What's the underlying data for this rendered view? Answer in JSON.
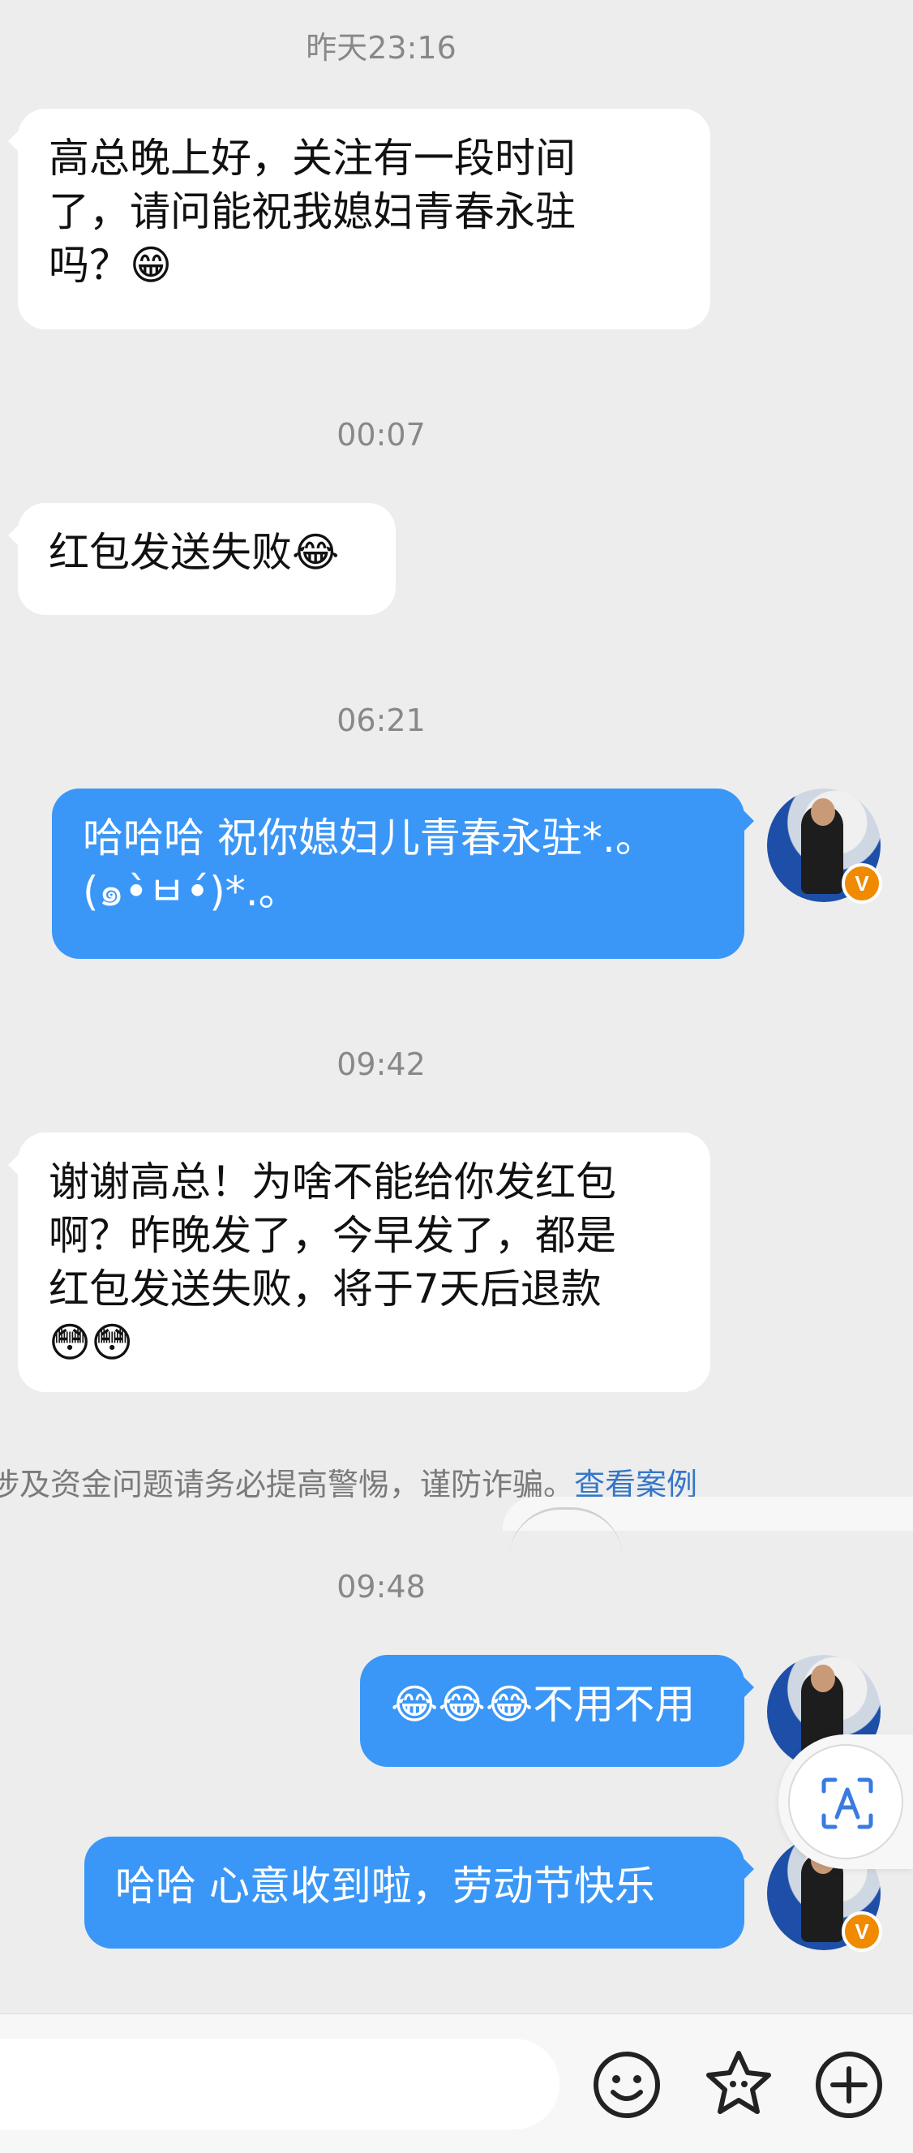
{
  "messages": [
    {
      "time": "昨天23:16",
      "side": "in",
      "lines": [
        "高总晚上好，关注有一段时间",
        "了，请问能祝我媳妇青春永驻",
        "吗？😁"
      ]
    },
    {
      "time": "00:07",
      "side": "in",
      "lines": [
        "红包发送失败😂"
      ]
    },
    {
      "time": "06:21",
      "side": "out",
      "lines": [
        "哈哈哈 祝你媳妇儿青春永驻*.。",
        "(๑•̀ㅂ•́)*.。"
      ]
    },
    {
      "time": "09:42",
      "side": "in",
      "lines": [
        "谢谢高总！为啥不能给你发红包",
        "啊？昨晚发了，今早发了，都是",
        "红包发送失败，将于7天后退款",
        "😳😳"
      ]
    },
    {
      "time": "09:48",
      "side": "out",
      "lines": [
        "😂😂😂不用不用"
      ]
    },
    {
      "time": "",
      "side": "out",
      "lines": [
        "哈哈 心意收到啦，劳动节快乐"
      ]
    }
  ],
  "notice": {
    "text": "涉及资金问题请务必提高警惕，谨防诈骗。",
    "link": "查看案例"
  },
  "colors": {
    "background": "#ededed",
    "incoming_bubble": "#ffffff",
    "outgoing_bubble": "#3a97f7",
    "link": "#3576c8",
    "verified_badge": "#f08a00"
  },
  "icons": {
    "verified_badge": "V",
    "emoji_button": "smiley-icon",
    "sticker_button": "star-face-icon",
    "more_button": "plus-icon",
    "ocr_button": "text-recognition-icon"
  }
}
